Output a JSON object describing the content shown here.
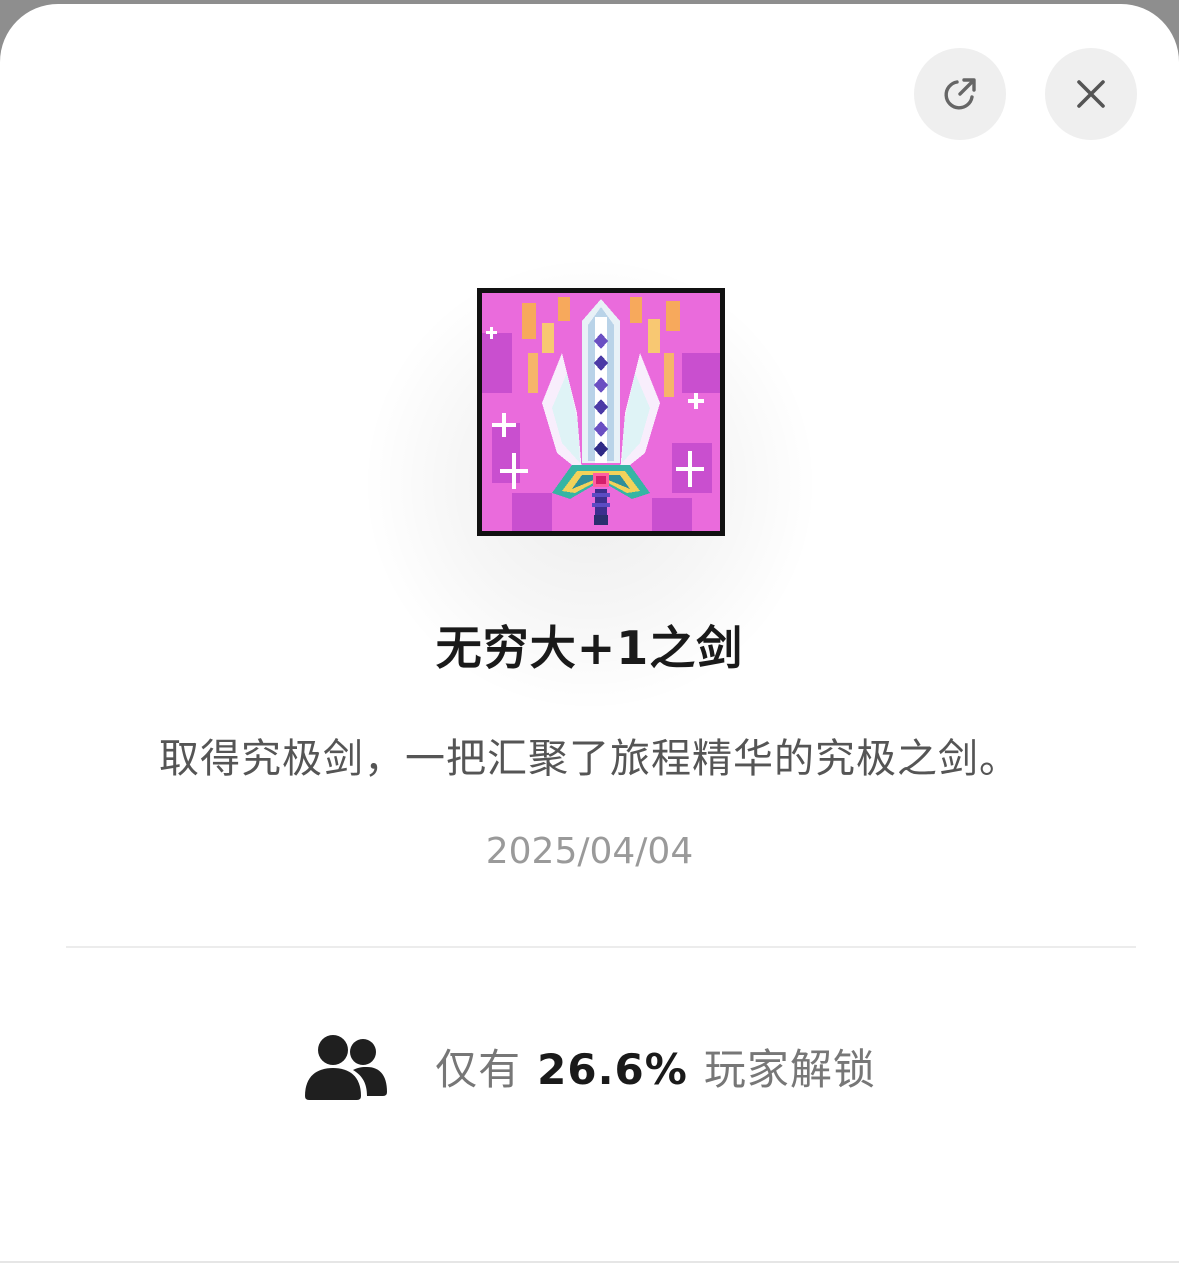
{
  "header": {
    "share_icon": "share-external-icon",
    "close_icon": "close-icon"
  },
  "achievement": {
    "icon": "pixel-sword-icon",
    "title": "无穷大+1之剑",
    "description": "取得究极剑，一把汇聚了旅程精华的究极之剑。",
    "date": "2025/04/04"
  },
  "stats": {
    "icon": "players-icon",
    "prefix": "仅有",
    "percent": "26.6%",
    "suffix": "玩家解锁"
  },
  "colors": {
    "icon_background": "#e65fd6",
    "title": "#1a1a1a",
    "description": "#555555",
    "date": "#9a9a9a",
    "button_background": "#efefef"
  }
}
